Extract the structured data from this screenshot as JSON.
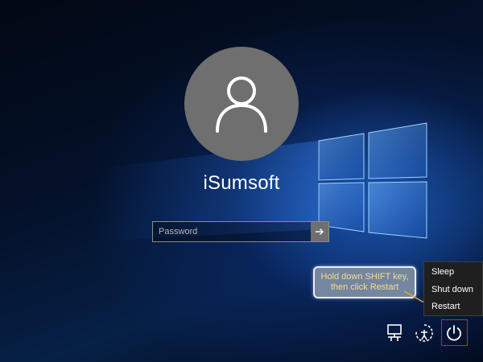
{
  "user": {
    "name": "iSumsoft"
  },
  "password": {
    "placeholder": "Password"
  },
  "tooltip": {
    "line1": "Hold down SHIFT key,",
    "line2": "then click Restart"
  },
  "power_menu": {
    "items": [
      "Sleep",
      "Shut down",
      "Restart"
    ]
  },
  "icons": {
    "avatar": "user-icon",
    "submit": "arrow-right-icon",
    "network": "network-icon",
    "ease_of_access": "ease-of-access-icon",
    "power": "power-icon"
  },
  "colors": {
    "avatar_bg": "#6f6f6f",
    "tooltip_bg": "#7486a0",
    "tooltip_text": "#f4df8a",
    "menu_bg": "#1f1f1f",
    "highlight": "#e02020"
  }
}
